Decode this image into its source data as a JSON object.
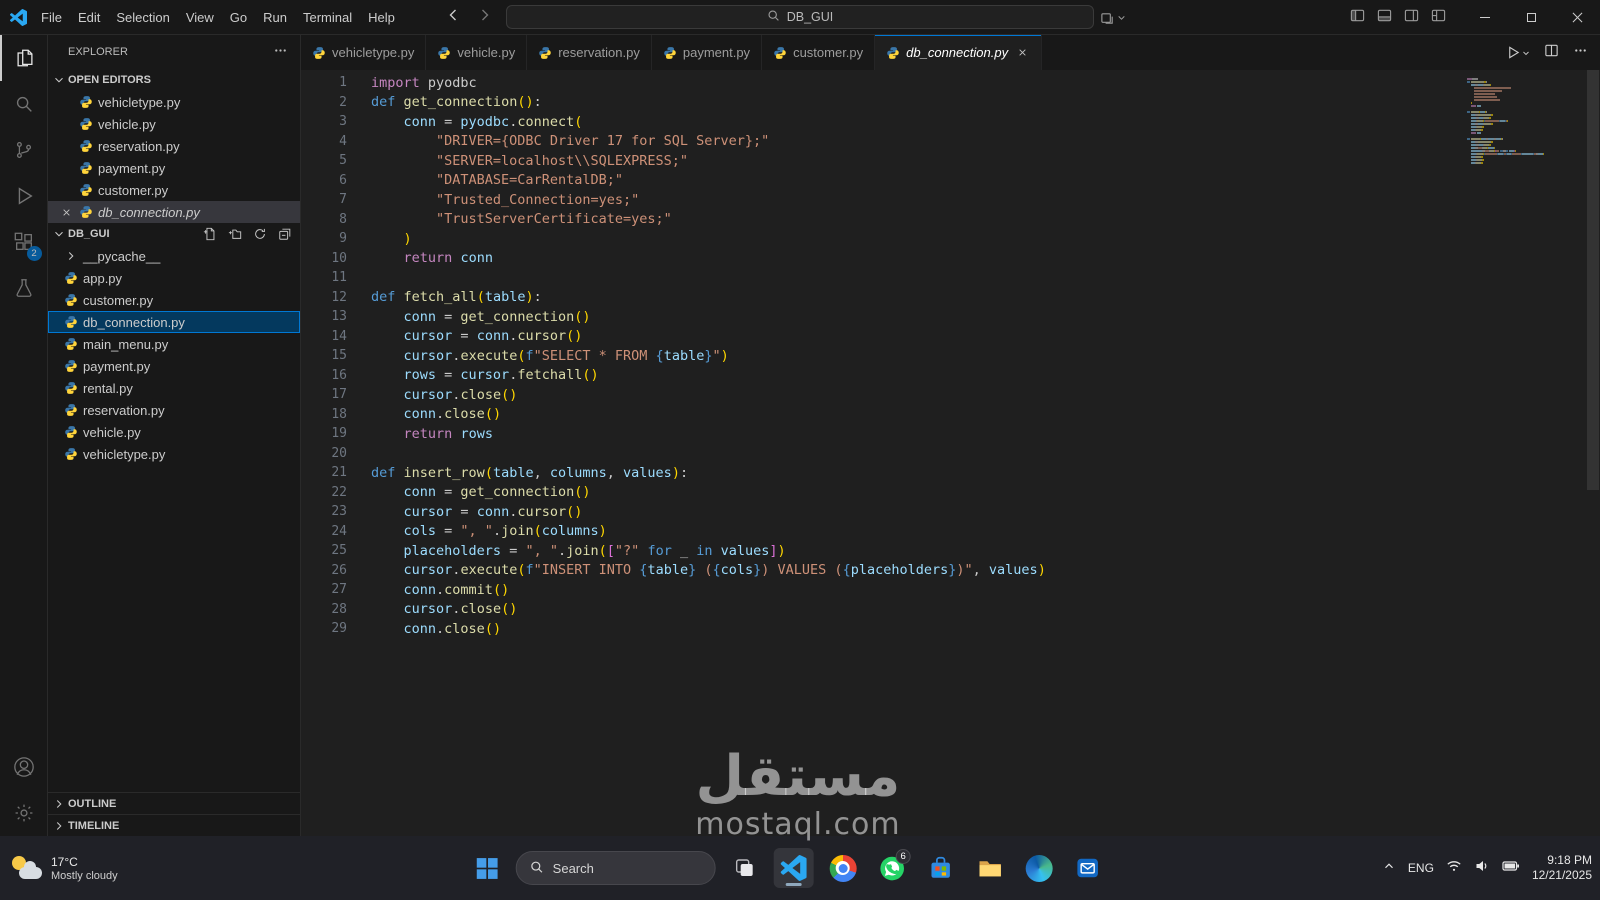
{
  "titlebar": {
    "menu": [
      "File",
      "Edit",
      "Selection",
      "View",
      "Go",
      "Run",
      "Terminal",
      "Help"
    ],
    "search_value": "DB_GUI"
  },
  "activity_bar": {
    "extensions_badge": "2"
  },
  "sidebar": {
    "title": "EXPLORER",
    "sections": {
      "open_editors": "OPEN EDITORS",
      "outline": "OUTLINE",
      "timeline": "TIMELINE"
    },
    "open_editors": [
      "vehicletype.py",
      "vehicle.py",
      "reservation.py",
      "payment.py",
      "customer.py",
      "db_connection.py"
    ],
    "open_editors_active": "db_connection.py",
    "project_name": "DB_GUI",
    "files": [
      {
        "name": "__pycache__",
        "kind": "folder",
        "selected": false
      },
      {
        "name": "app.py",
        "kind": "file",
        "selected": false
      },
      {
        "name": "customer.py",
        "kind": "file",
        "selected": false
      },
      {
        "name": "db_connection.py",
        "kind": "file",
        "selected": true
      },
      {
        "name": "main_menu.py",
        "kind": "file",
        "selected": false
      },
      {
        "name": "payment.py",
        "kind": "file",
        "selected": false
      },
      {
        "name": "rental.py",
        "kind": "file",
        "selected": false
      },
      {
        "name": "reservation.py",
        "kind": "file",
        "selected": false
      },
      {
        "name": "vehicle.py",
        "kind": "file",
        "selected": false
      },
      {
        "name": "vehicletype.py",
        "kind": "file",
        "selected": false
      }
    ]
  },
  "tabs": [
    {
      "name": "vehicletype.py",
      "active": false
    },
    {
      "name": "vehicle.py",
      "active": false
    },
    {
      "name": "reservation.py",
      "active": false
    },
    {
      "name": "payment.py",
      "active": false
    },
    {
      "name": "customer.py",
      "active": false
    },
    {
      "name": "db_connection.py",
      "active": true
    }
  ],
  "editor": {
    "token_colors": {
      "kw": "#569cd6",
      "ctrl": "#c586c0",
      "fn": "#dcdcaa",
      "var": "#9cdcfe",
      "str": "#ce9178",
      "plain": "#cccccc",
      "b1": "#ffd700",
      "b2": "#da70d6",
      "fb": "#569cd6"
    },
    "lines": [
      [
        [
          "ctrl",
          "import"
        ],
        [
          "plain",
          " pyodbc"
        ]
      ],
      [
        [
          "kw",
          "def"
        ],
        [
          "plain",
          " "
        ],
        [
          "fn",
          "get_connection"
        ],
        [
          "b1",
          "()"
        ],
        [
          "plain",
          ":"
        ]
      ],
      [
        [
          "plain",
          "    "
        ],
        [
          "var",
          "conn"
        ],
        [
          "plain",
          " = "
        ],
        [
          "var",
          "pyodbc"
        ],
        [
          "plain",
          "."
        ],
        [
          "fn",
          "connect"
        ],
        [
          "b1",
          "("
        ]
      ],
      [
        [
          "plain",
          "        "
        ],
        [
          "str",
          "\"DRIVER={ODBC Driver 17 for SQL Server};\""
        ]
      ],
      [
        [
          "plain",
          "        "
        ],
        [
          "str",
          "\"SERVER=localhost\\\\SQLEXPRESS;\""
        ]
      ],
      [
        [
          "plain",
          "        "
        ],
        [
          "str",
          "\"DATABASE=CarRentalDB;\""
        ]
      ],
      [
        [
          "plain",
          "        "
        ],
        [
          "str",
          "\"Trusted_Connection=yes;\""
        ]
      ],
      [
        [
          "plain",
          "        "
        ],
        [
          "str",
          "\"TrustServerCertificate=yes;\""
        ]
      ],
      [
        [
          "plain",
          "    "
        ],
        [
          "b1",
          ")"
        ]
      ],
      [
        [
          "plain",
          "    "
        ],
        [
          "ctrl",
          "return"
        ],
        [
          "plain",
          " "
        ],
        [
          "var",
          "conn"
        ]
      ],
      [],
      [
        [
          "kw",
          "def"
        ],
        [
          "plain",
          " "
        ],
        [
          "fn",
          "fetch_all"
        ],
        [
          "b1",
          "("
        ],
        [
          "var",
          "table"
        ],
        [
          "b1",
          ")"
        ],
        [
          "plain",
          ":"
        ]
      ],
      [
        [
          "plain",
          "    "
        ],
        [
          "var",
          "conn"
        ],
        [
          "plain",
          " = "
        ],
        [
          "fn",
          "get_connection"
        ],
        [
          "b1",
          "()"
        ]
      ],
      [
        [
          "plain",
          "    "
        ],
        [
          "var",
          "cursor"
        ],
        [
          "plain",
          " = "
        ],
        [
          "var",
          "conn"
        ],
        [
          "plain",
          "."
        ],
        [
          "fn",
          "cursor"
        ],
        [
          "b1",
          "()"
        ]
      ],
      [
        [
          "plain",
          "    "
        ],
        [
          "var",
          "cursor"
        ],
        [
          "plain",
          "."
        ],
        [
          "fn",
          "execute"
        ],
        [
          "b1",
          "("
        ],
        [
          "kw",
          "f"
        ],
        [
          "str",
          "\"SELECT * FROM "
        ],
        [
          "fb",
          "{"
        ],
        [
          "var",
          "table"
        ],
        [
          "fb",
          "}"
        ],
        [
          "str",
          "\""
        ],
        [
          "b1",
          ")"
        ]
      ],
      [
        [
          "plain",
          "    "
        ],
        [
          "var",
          "rows"
        ],
        [
          "plain",
          " = "
        ],
        [
          "var",
          "cursor"
        ],
        [
          "plain",
          "."
        ],
        [
          "fn",
          "fetchall"
        ],
        [
          "b1",
          "()"
        ]
      ],
      [
        [
          "plain",
          "    "
        ],
        [
          "var",
          "cursor"
        ],
        [
          "plain",
          "."
        ],
        [
          "fn",
          "close"
        ],
        [
          "b1",
          "()"
        ]
      ],
      [
        [
          "plain",
          "    "
        ],
        [
          "var",
          "conn"
        ],
        [
          "plain",
          "."
        ],
        [
          "fn",
          "close"
        ],
        [
          "b1",
          "()"
        ]
      ],
      [
        [
          "plain",
          "    "
        ],
        [
          "ctrl",
          "return"
        ],
        [
          "plain",
          " "
        ],
        [
          "var",
          "rows"
        ]
      ],
      [],
      [
        [
          "kw",
          "def"
        ],
        [
          "plain",
          " "
        ],
        [
          "fn",
          "insert_row"
        ],
        [
          "b1",
          "("
        ],
        [
          "var",
          "table"
        ],
        [
          "plain",
          ", "
        ],
        [
          "var",
          "columns"
        ],
        [
          "plain",
          ", "
        ],
        [
          "var",
          "values"
        ],
        [
          "b1",
          ")"
        ],
        [
          "plain",
          ":"
        ]
      ],
      [
        [
          "plain",
          "    "
        ],
        [
          "var",
          "conn"
        ],
        [
          "plain",
          " = "
        ],
        [
          "fn",
          "get_connection"
        ],
        [
          "b1",
          "()"
        ]
      ],
      [
        [
          "plain",
          "    "
        ],
        [
          "var",
          "cursor"
        ],
        [
          "plain",
          " = "
        ],
        [
          "var",
          "conn"
        ],
        [
          "plain",
          "."
        ],
        [
          "fn",
          "cursor"
        ],
        [
          "b1",
          "()"
        ]
      ],
      [
        [
          "plain",
          "    "
        ],
        [
          "var",
          "cols"
        ],
        [
          "plain",
          " = "
        ],
        [
          "str",
          "\", \""
        ],
        [
          "plain",
          "."
        ],
        [
          "fn",
          "join"
        ],
        [
          "b1",
          "("
        ],
        [
          "var",
          "columns"
        ],
        [
          "b1",
          ")"
        ]
      ],
      [
        [
          "plain",
          "    "
        ],
        [
          "var",
          "placeholders"
        ],
        [
          "plain",
          " = "
        ],
        [
          "str",
          "\", \""
        ],
        [
          "plain",
          "."
        ],
        [
          "fn",
          "join"
        ],
        [
          "b1",
          "("
        ],
        [
          "b2",
          "["
        ],
        [
          "str",
          "\"?\""
        ],
        [
          "plain",
          " "
        ],
        [
          "kw",
          "for"
        ],
        [
          "plain",
          " _ "
        ],
        [
          "kw",
          "in"
        ],
        [
          "plain",
          " "
        ],
        [
          "var",
          "values"
        ],
        [
          "b2",
          "]"
        ],
        [
          "b1",
          ")"
        ]
      ],
      [
        [
          "plain",
          "    "
        ],
        [
          "var",
          "cursor"
        ],
        [
          "plain",
          "."
        ],
        [
          "fn",
          "execute"
        ],
        [
          "b1",
          "("
        ],
        [
          "kw",
          "f"
        ],
        [
          "str",
          "\"INSERT INTO "
        ],
        [
          "fb",
          "{"
        ],
        [
          "var",
          "table"
        ],
        [
          "fb",
          "}"
        ],
        [
          "str",
          " ("
        ],
        [
          "fb",
          "{"
        ],
        [
          "var",
          "cols"
        ],
        [
          "fb",
          "}"
        ],
        [
          "str",
          ") VALUES ("
        ],
        [
          "fb",
          "{"
        ],
        [
          "var",
          "placeholders"
        ],
        [
          "fb",
          "}"
        ],
        [
          "str",
          ")\""
        ],
        [
          "plain",
          ", "
        ],
        [
          "var",
          "values"
        ],
        [
          "b1",
          ")"
        ]
      ],
      [
        [
          "plain",
          "    "
        ],
        [
          "var",
          "conn"
        ],
        [
          "plain",
          "."
        ],
        [
          "fn",
          "commit"
        ],
        [
          "b1",
          "()"
        ]
      ],
      [
        [
          "plain",
          "    "
        ],
        [
          "var",
          "cursor"
        ],
        [
          "plain",
          "."
        ],
        [
          "fn",
          "close"
        ],
        [
          "b1",
          "()"
        ]
      ],
      [
        [
          "plain",
          "    "
        ],
        [
          "var",
          "conn"
        ],
        [
          "plain",
          "."
        ],
        [
          "fn",
          "close"
        ],
        [
          "b1",
          "()"
        ]
      ]
    ]
  },
  "watermark": {
    "arabic": "مستقل",
    "latin": "mostaql.com"
  },
  "taskbar": {
    "weather": {
      "temp": "17°C",
      "desc": "Mostly cloudy"
    },
    "search_label": "Search",
    "whatsapp_badge": "6",
    "tray": {
      "language": "ENG",
      "time": "9:18 PM",
      "date": "12/21/2025"
    }
  },
  "colors": {
    "accent": "#0078d4",
    "selection": "#04395e",
    "editor_bg": "#1f1f1f",
    "chrome_bg": "#181818"
  }
}
